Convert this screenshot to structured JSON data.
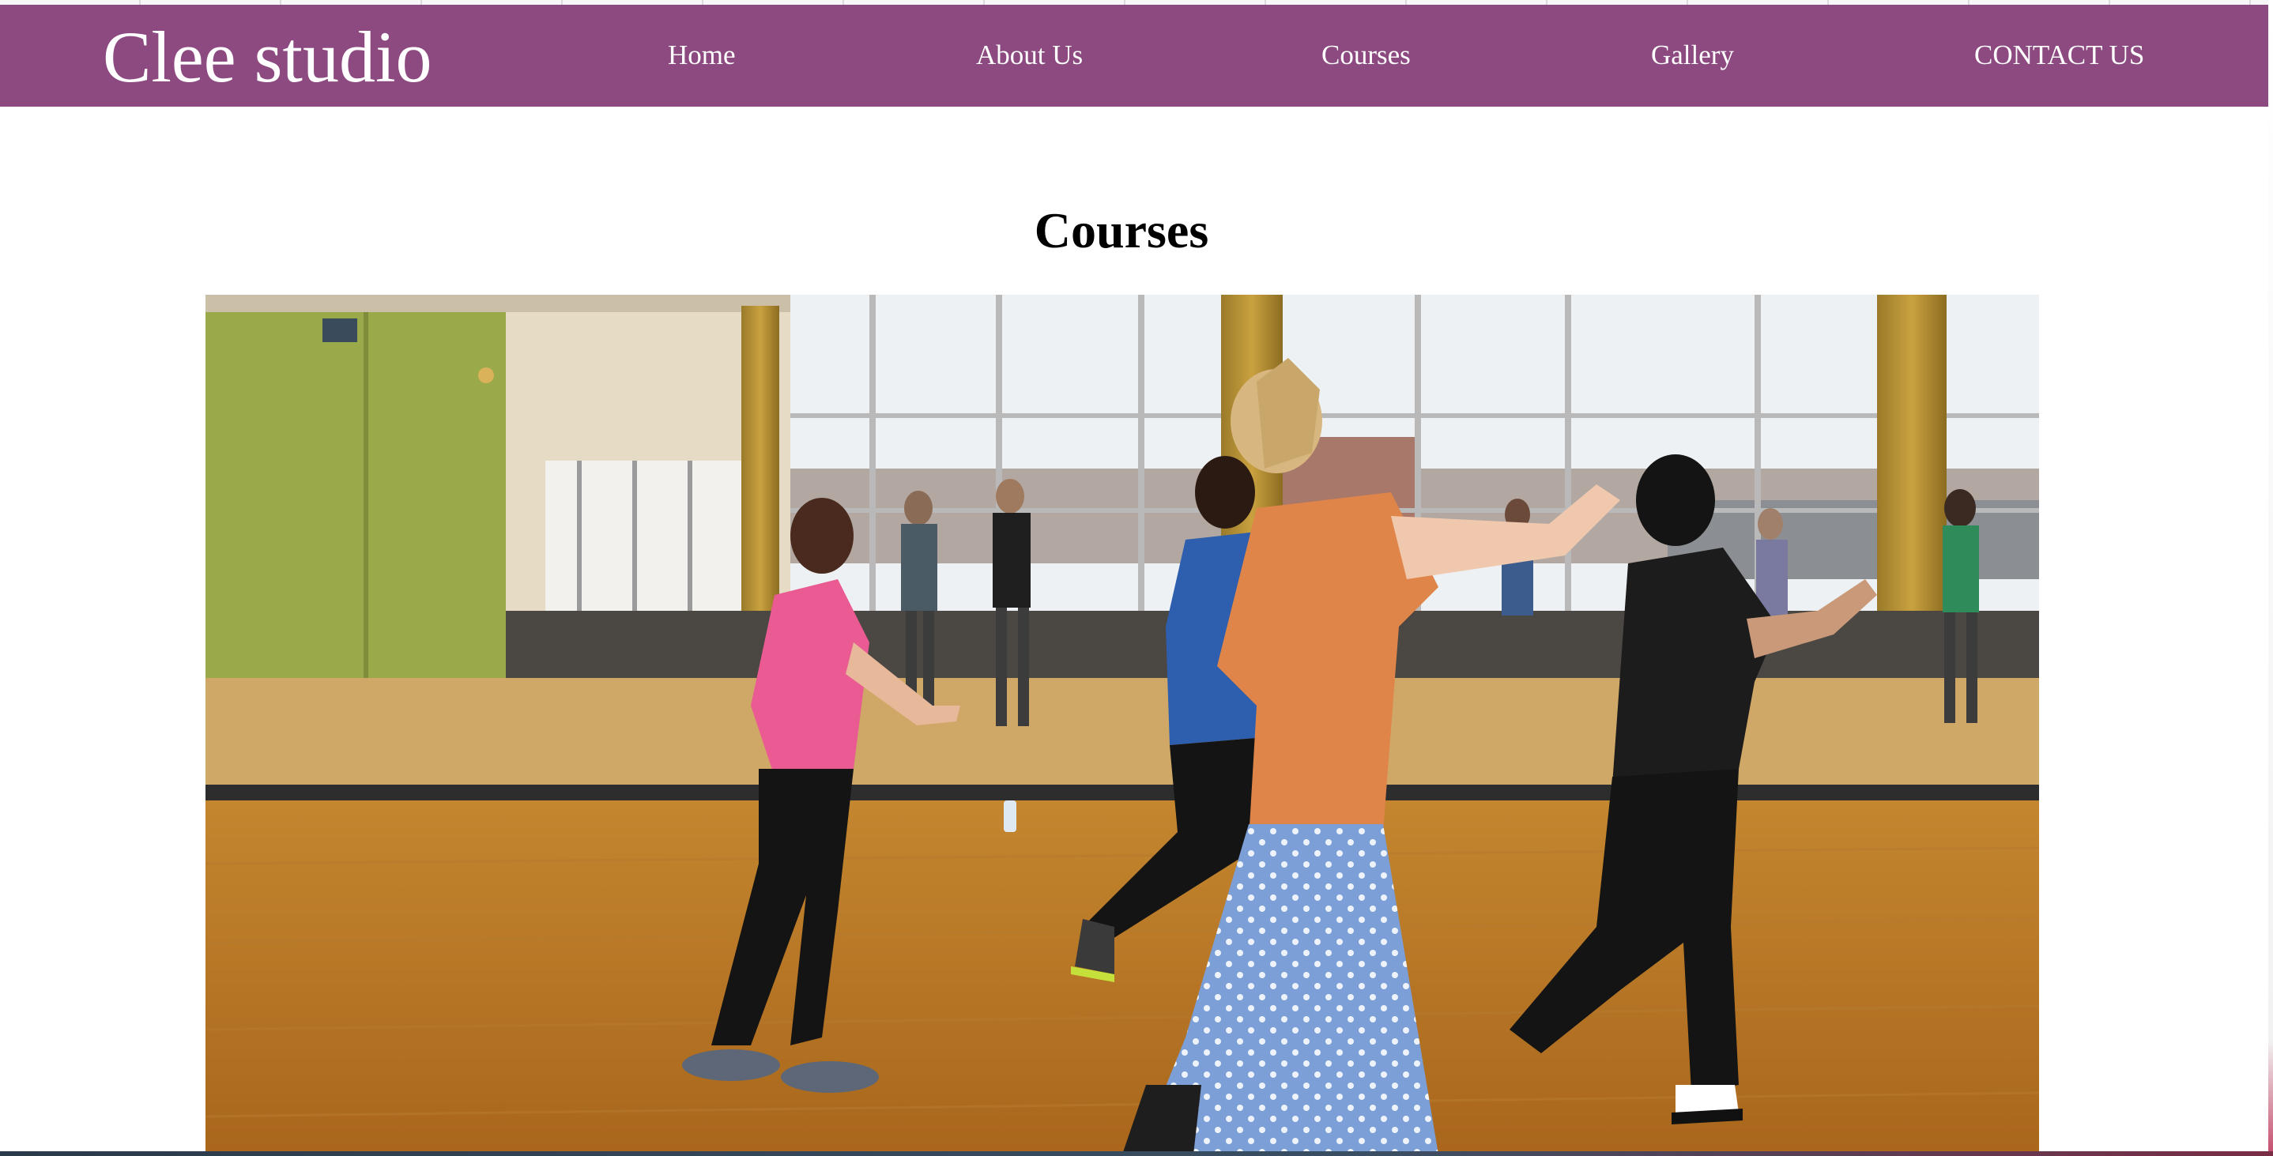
{
  "navbar": {
    "brand": "Clee studio",
    "links": [
      {
        "label": "Home"
      },
      {
        "label": "About Us"
      },
      {
        "label": "Courses"
      },
      {
        "label": "Gallery"
      },
      {
        "label": "CONTACT US"
      }
    ]
  },
  "main": {
    "title": "Courses"
  },
  "colors": {
    "navbar_bg": "#8d4a80",
    "nav_text": "#ffffff",
    "title_text": "#000000"
  }
}
